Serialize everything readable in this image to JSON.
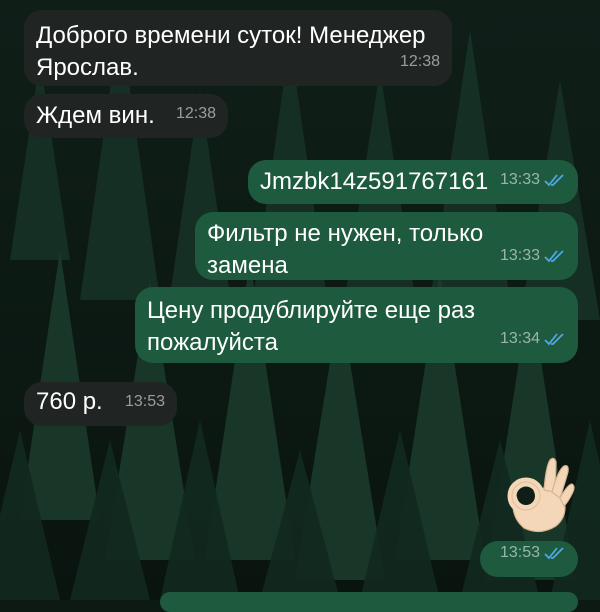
{
  "chat": {
    "messages": [
      {
        "direction": "incoming",
        "text": "Доброго времени суток!  Менеджер\nЯрослав.",
        "time": "12:38"
      },
      {
        "direction": "incoming",
        "text": "Ждем вин.",
        "time": "12:38"
      },
      {
        "direction": "outgoing",
        "text": "Jmzbk14z591767161",
        "time": "13:33",
        "status": "read"
      },
      {
        "direction": "outgoing",
        "text": "Фильтр не нужен, только замена",
        "time": "13:33",
        "status": "read"
      },
      {
        "direction": "outgoing",
        "text": "Цену продублируйте еще раз\nпожалуйста",
        "time": "13:34",
        "status": "read"
      },
      {
        "direction": "incoming",
        "text": "760 р.",
        "time": "13:53"
      },
      {
        "direction": "outgoing",
        "content": "ok-hand-emoji",
        "time": "13:53",
        "status": "read"
      }
    ]
  },
  "colors": {
    "incoming_bubble": "#202523",
    "outgoing_bubble": "#1e5a3e",
    "read_ticks": "#4fa6e8",
    "wallpaper": "#0d1a14"
  }
}
